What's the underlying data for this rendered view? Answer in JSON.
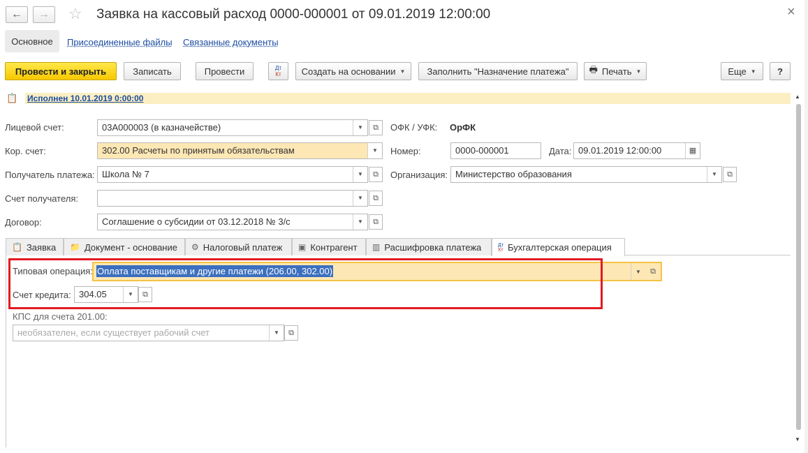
{
  "window": {
    "title": "Заявка на кассовый расход 0000-000001 от 09.01.2019 12:00:00"
  },
  "icons": {
    "back": "←",
    "forward": "→",
    "favorite": "☆",
    "close": "×",
    "dropdown": "▼",
    "open": "⧉",
    "calendar": "▦",
    "print": "🖶",
    "document": "📋",
    "doc_basis": "📁",
    "tax": "⚙",
    "counterparty": "▣",
    "decode": "▥",
    "dt": "Дт",
    "kt": "Кт",
    "scroll_up": "▲",
    "scroll_down": "▼"
  },
  "section_tabs": {
    "main": "Основное",
    "attached_files": "Присоединенные файлы",
    "related_docs": "Связанные документы"
  },
  "toolbar": {
    "post_close": "Провести и закрыть",
    "save": "Записать",
    "post": "Провести",
    "create_based": "Создать на основании",
    "fill_purpose": "Заполнить \"Назначение платежа\"",
    "print": "Печать",
    "more": "Еще",
    "help": "?"
  },
  "status": {
    "text": "Исполнен 10.01.2019 0:00:00"
  },
  "form": {
    "personal_account": {
      "label": "Лицевой счет:",
      "value": "03А000003 (в казначействе)"
    },
    "ofk": {
      "label": "ОФК / УФК:",
      "value": "ОрФК"
    },
    "corr_account": {
      "label": "Кор. счет:",
      "value": "302.00 Расчеты по принятым обязательствам"
    },
    "number": {
      "label": "Номер:",
      "value": "0000-000001"
    },
    "date": {
      "label": "Дата:",
      "value": "09.01.2019 12:00:00"
    },
    "recipient": {
      "label": "Получатель платежа:",
      "value": "Школа № 7"
    },
    "organization": {
      "label": "Организация:",
      "value": "Министерство образования"
    },
    "recipient_account": {
      "label": "Счет получателя:",
      "value": ""
    },
    "contract": {
      "label": "Договор:",
      "value": "Соглашение о субсидии от 03.12.2018 № 3/с"
    }
  },
  "tabs": [
    {
      "label": "Заявка"
    },
    {
      "label": "Документ - основание"
    },
    {
      "label": "Налоговый платеж"
    },
    {
      "label": "Контрагент"
    },
    {
      "label": "Расшифровка платежа"
    },
    {
      "label": "Бухгалтерская операция"
    }
  ],
  "accounting": {
    "typical_op": {
      "label": "Типовая операция:",
      "value": "Оплата поставщикам и другие платежи (206.00, 302.00)"
    },
    "credit_account": {
      "label": "Счет кредита:",
      "value": "304.05"
    },
    "kps": {
      "label": "КПС для счета 201.00:",
      "placeholder": "необязателен, если существует рабочий счет"
    }
  }
}
